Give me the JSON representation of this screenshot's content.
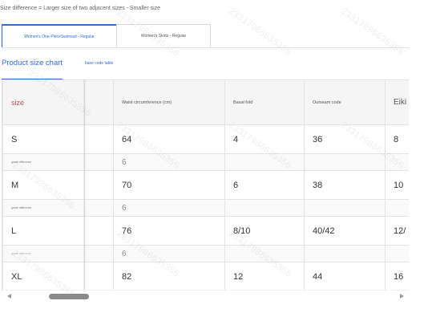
{
  "note": "Size difference = Larger size of two adjacent sizes - Smaller size",
  "tabs": [
    {
      "label": "Women's One-PieceSwimsuit - Regular",
      "active": true
    },
    {
      "label": "Women's Skirts - Regular",
      "active": false
    }
  ],
  "subnav": {
    "size_chart": "Product size chart",
    "base_code_table": "base code table"
  },
  "table": {
    "headers": [
      "size",
      "",
      "Waist circumference (cm)",
      "Basal fold",
      "Outseam code",
      "Eiki"
    ],
    "rows": [
      {
        "kind": "size",
        "cells": [
          "S",
          "",
          "64",
          "4",
          "36",
          "8"
        ]
      },
      {
        "kind": "diff",
        "cells": [
          "grade difference",
          "",
          "6",
          "",
          "",
          ""
        ]
      },
      {
        "kind": "size",
        "cells": [
          "M",
          "",
          "70",
          "6",
          "38",
          "10"
        ]
      },
      {
        "kind": "diff",
        "cells": [
          "grade difference",
          "",
          "6",
          "",
          "",
          ""
        ]
      },
      {
        "kind": "size",
        "cells": [
          "L",
          "",
          "76",
          "8/10",
          "40/42",
          "12/"
        ]
      },
      {
        "kind": "diff",
        "cells": [
          "grade difference",
          "",
          "6",
          "",
          "",
          ""
        ]
      },
      {
        "kind": "size",
        "cells": [
          "XL",
          "",
          "82",
          "12",
          "44",
          "16"
        ]
      }
    ]
  },
  "watermark": "23317986635356",
  "colors": {
    "accent": "#2f6bd9",
    "size_header": "#c0504d",
    "header_bg": "#f5f5f5",
    "border": "#e3e3e3"
  }
}
